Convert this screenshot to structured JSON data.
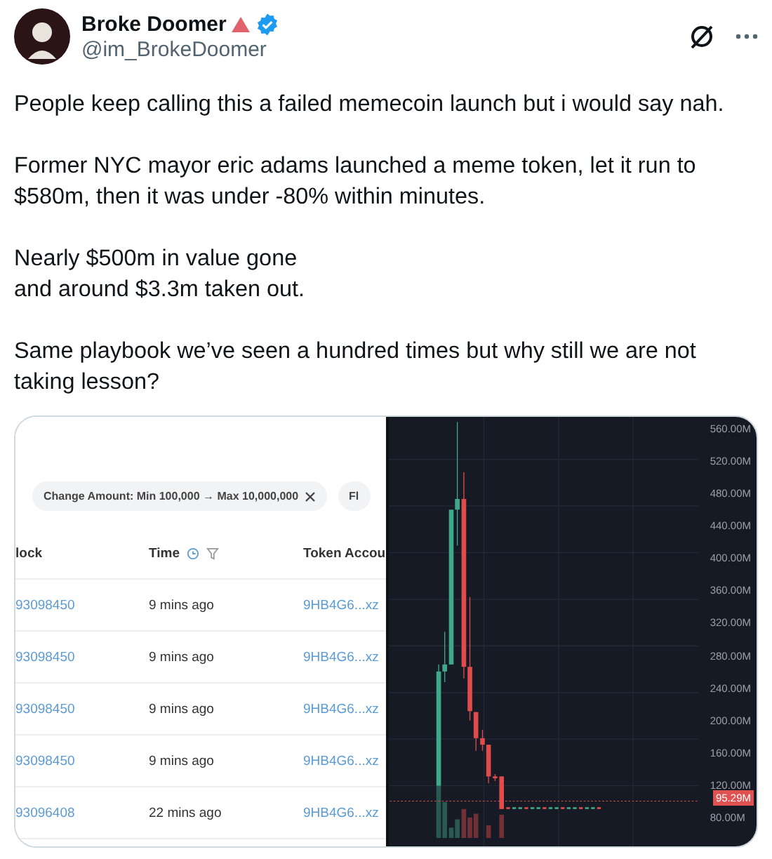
{
  "author": {
    "name": "Broke Doomer",
    "handle": "@im_BrokeDoomer",
    "verified": true
  },
  "paragraphs": [
    "People keep calling this a failed memecoin launch but i would say nah.",
    "Former NYC mayor eric adams launched a meme token, let it run to $580m, then it was under -80% within minutes.",
    "Nearly $500m in value gone\nand around $3.3m taken out.",
    "Same playbook we’ve seen a hundred times but why still we are not taking lesson?"
  ],
  "table_screenshot": {
    "filter_chip": "Change Amount: Min 100,000 → Max 10,000,000",
    "next_chip": "Fl",
    "columns": [
      "lock",
      "Time",
      "Token Accou"
    ],
    "rows": [
      {
        "block": "93098450",
        "time": "9 mins ago",
        "token_account": "9HB4G6...xz"
      },
      {
        "block": "93098450",
        "time": "9 mins ago",
        "token_account": "9HB4G6...xz"
      },
      {
        "block": "93098450",
        "time": "9 mins ago",
        "token_account": "9HB4G6...xz"
      },
      {
        "block": "93098450",
        "time": "9 mins ago",
        "token_account": "9HB4G6...xz"
      },
      {
        "block": "93096408",
        "time": "22 mins ago",
        "token_account": "9HB4G6...xz"
      }
    ]
  },
  "chart_screenshot": {
    "axis_labels": [
      "560.00M",
      "520.00M",
      "480.00M",
      "440.00M",
      "400.00M",
      "360.00M",
      "320.00M",
      "280.00M",
      "240.00M",
      "200.00M",
      "160.00M",
      "120.00M",
      "80.00M"
    ],
    "price_badge": "95.29M"
  }
}
